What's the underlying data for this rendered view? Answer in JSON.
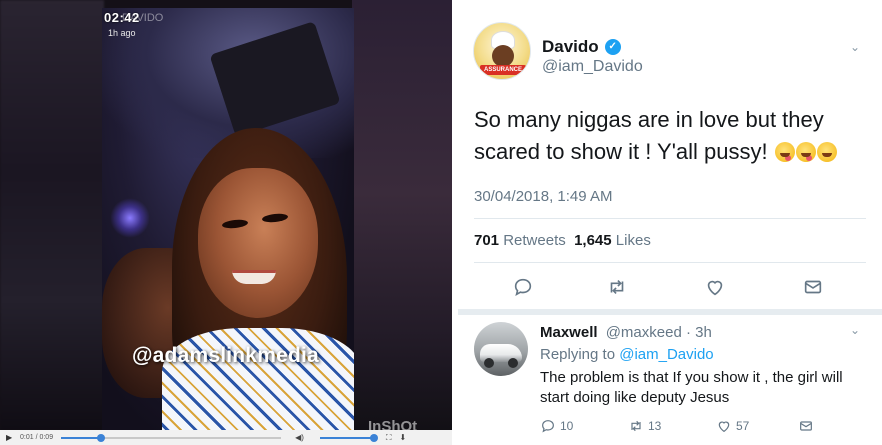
{
  "video": {
    "clock": "02:42",
    "ghost_brand": "DAVIDO",
    "posted_ago": "1h ago",
    "watermark": "@adamslinkmedia",
    "inshot_mark": "InShOt",
    "player": {
      "time": "0:01 / 0:09",
      "progress": 0.18,
      "volume": 1.0
    }
  },
  "tweet": {
    "author_name": "Davido",
    "author_handle": "@iam_Davido",
    "avatar_banner": "ASSURANCE",
    "text": "So many niggas are in love but they scared to show it ! Y'all pussy!",
    "emojis": [
      "winking-tongue-emoji",
      "winking-tongue-emoji",
      "grinning-emoji"
    ],
    "date": "30/04/2018, 1:49 AM",
    "retweets_count": "701",
    "retweets_label": "Retweets",
    "likes_count": "1,645",
    "likes_label": "Likes",
    "colors": {
      "accent": "#1da1f2",
      "muted": "#657786",
      "text": "#14171a"
    }
  },
  "reply": {
    "name": "Maxwell",
    "handle": "@maxkeed",
    "age": "· 3h",
    "replying_prefix": "Replying to",
    "replying_to": "@iam_Davido",
    "text": "The problem is that If you show it , the girl will start doing like deputy Jesus",
    "reply_count": "10",
    "retweet_count": "13",
    "like_count": "57"
  }
}
